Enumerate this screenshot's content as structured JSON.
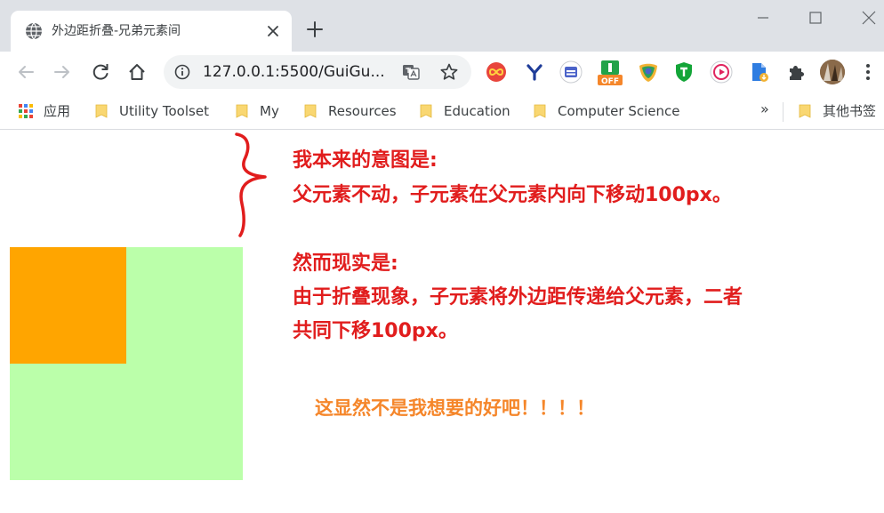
{
  "browser": {
    "tab": {
      "title": "外边距折叠-兄弟元素间"
    },
    "omnibox": {
      "url": "127.0.0.1:5500/GuiGu..."
    },
    "bookmarks": {
      "items": [
        {
          "label": "应用",
          "icon": "apps-grid-icon"
        },
        {
          "label": "Utility Toolset",
          "icon": "folder-icon"
        },
        {
          "label": "My",
          "icon": "folder-icon"
        },
        {
          "label": "Resources",
          "icon": "folder-icon"
        },
        {
          "label": "Education",
          "icon": "folder-icon"
        },
        {
          "label": "Computer Science",
          "icon": "folder-icon"
        }
      ],
      "more_label": "»",
      "other_label": "其他书签"
    }
  },
  "page": {
    "intent": {
      "heading": "我本来的意图是:",
      "body": "父元素不动，子元素在父元素内向下移动100px。"
    },
    "reality": {
      "heading": "然而现实是:",
      "line1": "由于折叠现象，子元素将外边距传递给父元素，二者",
      "line2": "共同下移100px。"
    },
    "comment": "这显然不是我想要的好吧！！！！",
    "colors": {
      "parent_box": "#bbffaa",
      "child_box": "#ffa500",
      "annotation_red": "#e11d1d",
      "comment_orange": "#f5862a"
    }
  }
}
